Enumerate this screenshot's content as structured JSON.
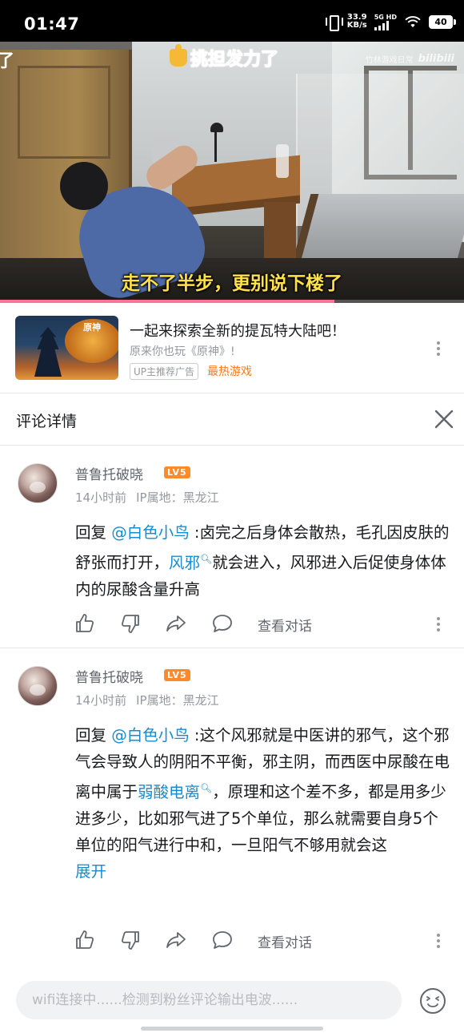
{
  "status_bar": {
    "time": "01:47",
    "net_speed_value": "33.9",
    "net_speed_unit": "KB/s",
    "network_label": "5G HD",
    "battery": "40"
  },
  "video": {
    "left_cut_text": "了",
    "overlay_title": "挑担发力了",
    "watermark": "竹林游戏日常",
    "watermark_logo": "bilibili",
    "subtitle": "走不了半步，更别说下楼了",
    "progress": 0.72
  },
  "ad": {
    "title": "一起来探索全新的提瓦特大陆吧！",
    "subtitle": "原来你也玩《原神》!",
    "tag": "UP主推荐广告",
    "hot_label": "最热游戏",
    "thumb_text": "原神"
  },
  "comment_panel": {
    "title": "评论详情"
  },
  "comments": [
    {
      "username": "普鲁托破晓",
      "level": "LV5",
      "time": "14小时前",
      "ip": "IP属地：黑龙江",
      "reply_prefix": "回复 ",
      "mention": "@白色小鸟",
      "text_1": " :卤完之后身体会散热，毛孔因皮肤的舒张而打开，",
      "link_1": "风邪",
      "text_2": "就会进入，风邪进入后促使身体体内的尿酸含量升高",
      "view_conversation": "查看对话"
    },
    {
      "username": "普鲁托破晓",
      "level": "LV5",
      "time": "14小时前",
      "ip": "IP属地：黑龙江",
      "reply_prefix": "回复 ",
      "mention": "@白色小鸟",
      "text_1": " :这个风邪就是中医讲的邪气，这个邪气会导致人的阴阳不平衡，邪主阴，而西医中尿酸在电离中属于",
      "link_1": "弱酸电离",
      "text_2": "，原理和这个差不多，都是用多少进多少，比如邪气进了5个单位，那么就需要自身5个单位的阳气进行中和，一旦阳气不够用就会这",
      "expand": "展开",
      "view_conversation": "查看对话"
    }
  ],
  "bottom_bar": {
    "input_placeholder": "wifi连接中......检测到粉丝评论输出电波......"
  },
  "colors": {
    "accent_pink": "#fb7299",
    "link_blue": "#178bcf",
    "level_orange": "#ff8a2a",
    "hot_orange": "#ff7a1a"
  }
}
